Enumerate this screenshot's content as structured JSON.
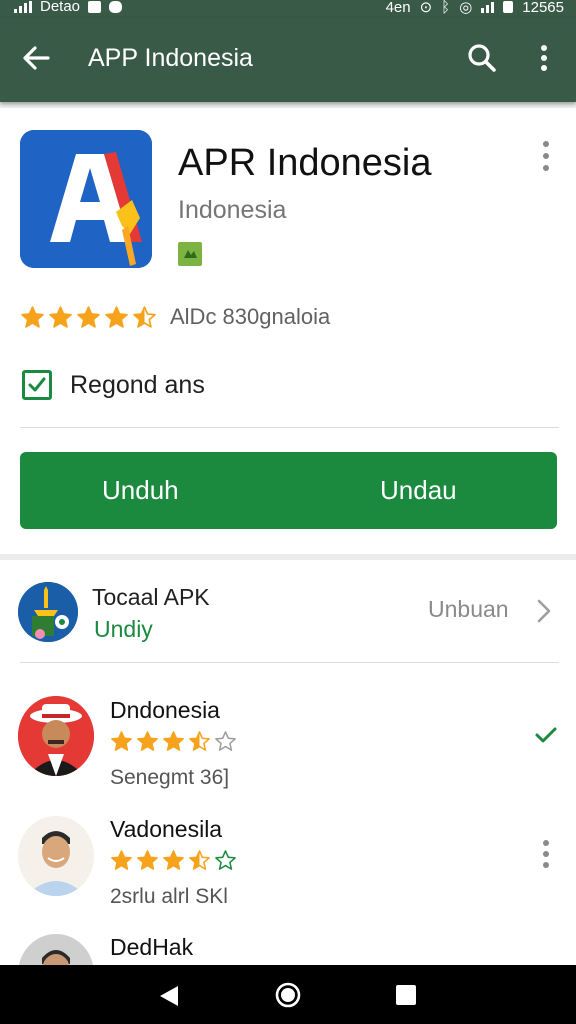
{
  "status_bar": {
    "carrier": "Detao",
    "time": "12565",
    "network": "4en"
  },
  "app_bar": {
    "title": "APP Indonesia"
  },
  "app": {
    "name": "APR Indonesia",
    "developer": "Indonesia",
    "rating_value": 4.5,
    "rating_text": "AlDc 830gnaloia",
    "checkbox_label": "Regond ans",
    "checkbox_checked": true,
    "button_left": "Unduh",
    "button_right": "Undau"
  },
  "promo": {
    "title": "Tocaal APK",
    "subtitle": "Undiy",
    "action": "Unbuan",
    "icon": "pagoda-icon"
  },
  "reviews": [
    {
      "name": "Dndonesia",
      "stars": 3.5,
      "meta": "Senegmt 36]",
      "trailing_icon": "check-icon"
    },
    {
      "name": "Vadonesila",
      "stars": 3.5,
      "meta": "2srlu alrl SKl",
      "trailing_icon": "more-vert-icon"
    },
    {
      "name": "DedHak",
      "stars": null,
      "meta": "",
      "trailing_icon": ""
    }
  ],
  "colors": {
    "app_bar": "#3a5a48",
    "accent_green": "#1b8a3e",
    "star_orange": "#f6a31b",
    "app_icon_blue": "#1f63c4"
  },
  "nav": {
    "icons": [
      "back-icon",
      "home-icon",
      "recents-icon"
    ]
  }
}
